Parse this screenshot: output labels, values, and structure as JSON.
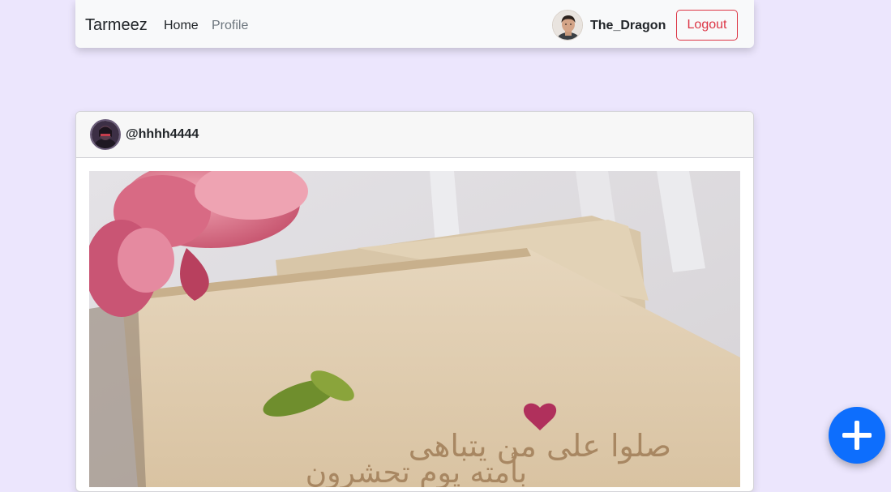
{
  "navbar": {
    "brand": "Tarmeez",
    "links": [
      {
        "label": "Home"
      },
      {
        "label": "Profile"
      }
    ],
    "user": {
      "username": "The_Dragon",
      "avatar_icon": "user-avatar-photo"
    },
    "logout_label": "Logout"
  },
  "post": {
    "author": {
      "username": "@hhhh4444",
      "avatar_icon": "author-avatar-photo"
    },
    "image": {
      "text_line_1": "صلوا على من يتباهى",
      "text_line_2": "بأمته يوم تحشرون"
    }
  },
  "fab": {
    "icon": "plus-icon"
  },
  "colors": {
    "background": "#ece6fd",
    "primary": "#0d6efd",
    "danger": "#dc3545",
    "navbar": "#f8f9fa"
  }
}
